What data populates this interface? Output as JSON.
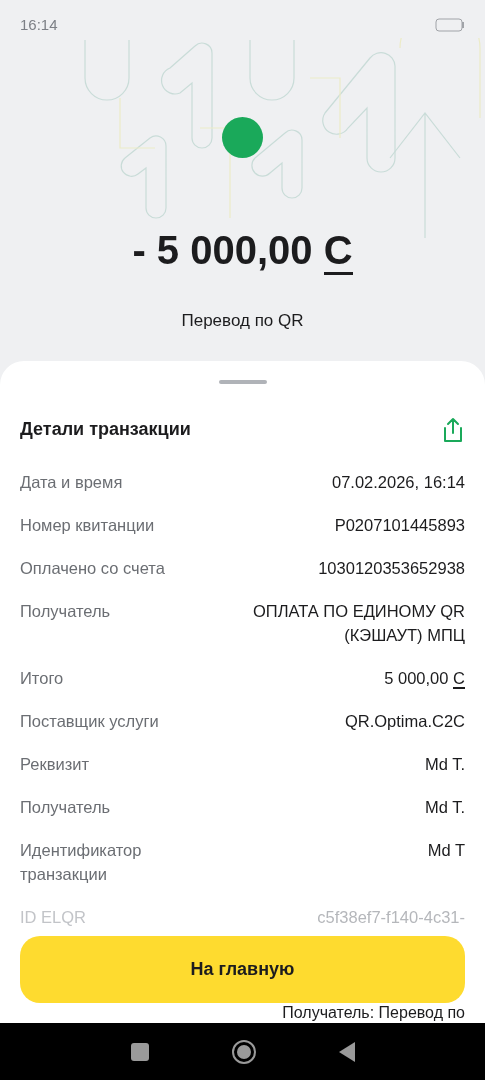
{
  "status_bar": {
    "time": "16:14"
  },
  "hero": {
    "amount": "- 5 000,00",
    "currency": "С",
    "subtitle": "Перевод по QR"
  },
  "details": {
    "title": "Детали транзакции",
    "rows": [
      {
        "kind": "text",
        "label": "Дата и время",
        "value": "07.02.2026, 16:14"
      },
      {
        "kind": "text",
        "label": "Номер квитанции",
        "value": "P0207101445893"
      },
      {
        "kind": "text",
        "label": "Оплачено со счета",
        "value": "1030120353652938"
      },
      {
        "kind": "text",
        "label": "Получатель",
        "value": "ОПЛАТА ПО ЕДИНОМУ QR (КЭШАУТ) МПЦ"
      },
      {
        "kind": "amount",
        "label": "Итого",
        "value": "5 000,00",
        "currency": "С"
      },
      {
        "kind": "text",
        "label": "Поставщик услуги",
        "value": "QR.Optima.C2C"
      },
      {
        "kind": "text",
        "label": "Реквизит",
        "value": "Md T."
      },
      {
        "kind": "text",
        "label": "Получатель",
        "value": "Md T."
      },
      {
        "kind": "text",
        "label": "Идентификатор транзакции",
        "value": "Md T"
      },
      {
        "kind": "faded",
        "label": "ID ELQR",
        "value": "c5f38ef7-f140-4c31-"
      }
    ]
  },
  "button": {
    "label": "На главную"
  },
  "cut_text": "Получатель: Перевод по"
}
